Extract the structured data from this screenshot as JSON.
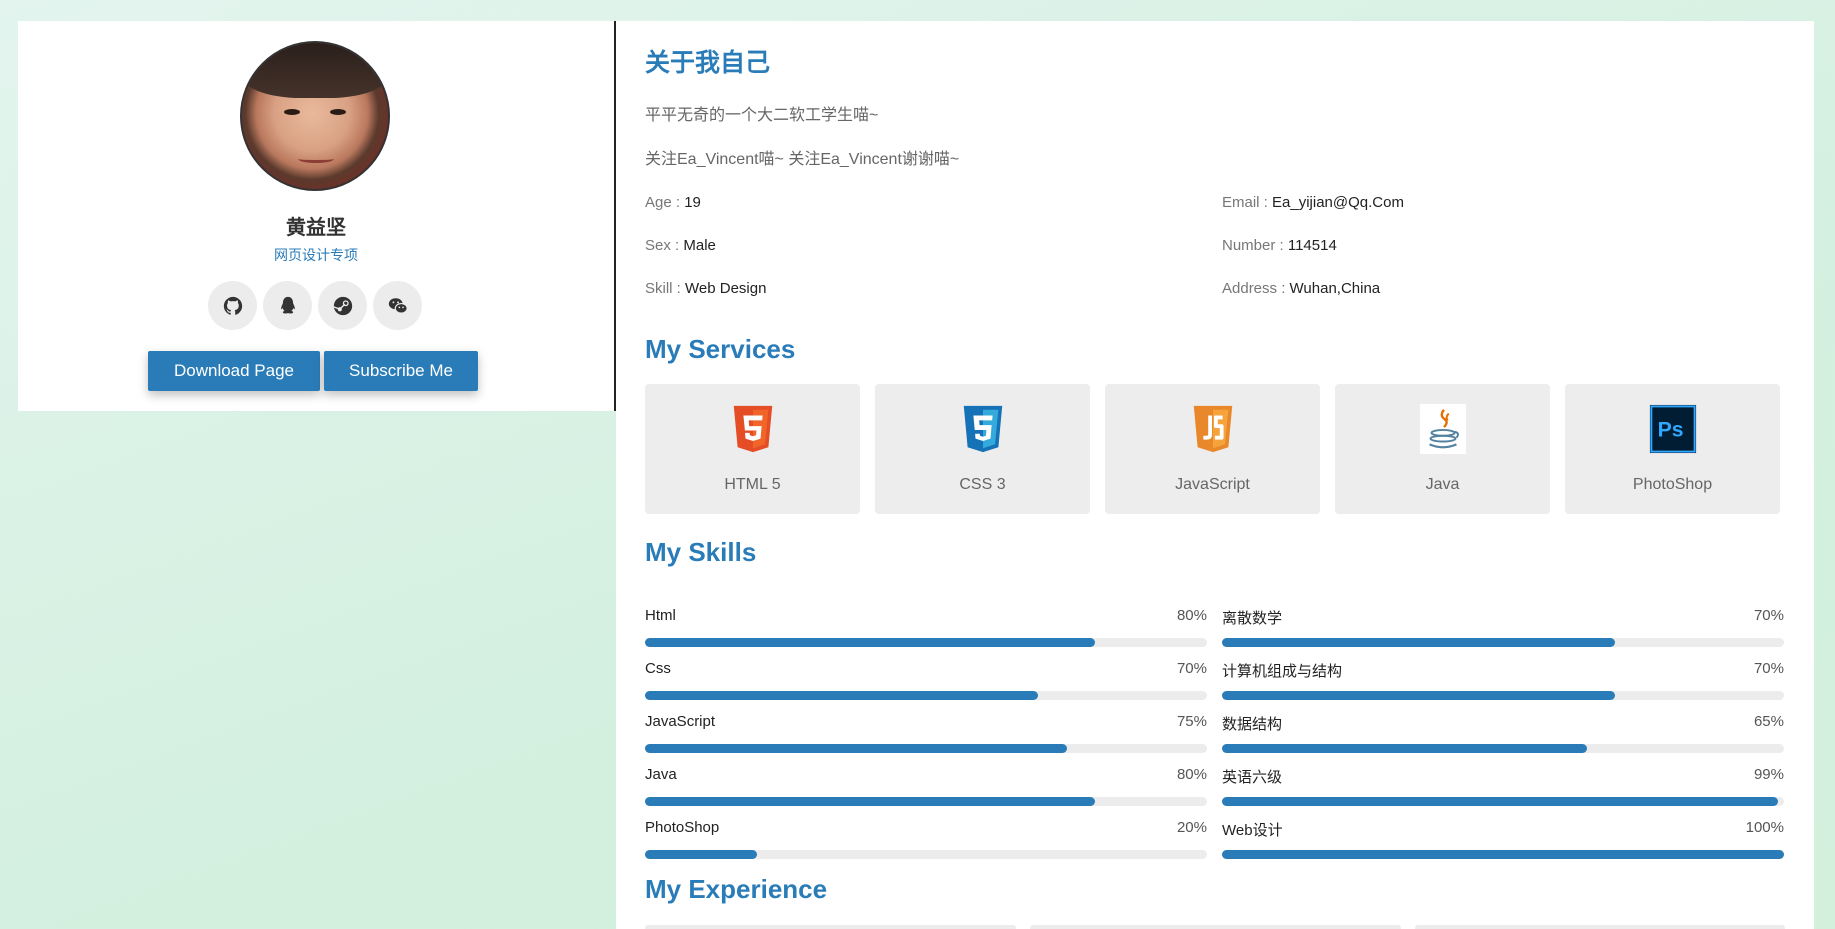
{
  "profile": {
    "name": "黄益坚",
    "subtitle": "网页设计专项",
    "socials": [
      "github-icon",
      "qq-icon",
      "steam-icon",
      "wechat-icon"
    ],
    "buttons": {
      "download": "Download Page",
      "subscribe": "Subscribe Me"
    }
  },
  "about": {
    "title": "关于我自己",
    "line1": "平平无奇的一个大二软工学生喵~",
    "line2": "关注Ea_Vincent喵~ 关注Ea_Vincent谢谢喵~",
    "info": [
      {
        "k": "Age : ",
        "v": "19"
      },
      {
        "k": "Email : ",
        "v": "Ea_yijian@Qq.Com"
      },
      {
        "k": "Sex : ",
        "v": "Male"
      },
      {
        "k": "Number : ",
        "v": "114514"
      },
      {
        "k": "Skill : ",
        "v": "Web Design"
      },
      {
        "k": "Address : ",
        "v": "Wuhan,China"
      }
    ]
  },
  "services": {
    "title": "My Services",
    "items": [
      {
        "label": "HTML 5",
        "icon": "html5-icon"
      },
      {
        "label": "CSS 3",
        "icon": "css3-icon"
      },
      {
        "label": "JavaScript",
        "icon": "javascript-icon"
      },
      {
        "label": "Java",
        "icon": "java-icon"
      },
      {
        "label": "PhotoShop",
        "icon": "photoshop-icon"
      }
    ]
  },
  "skills": {
    "title": "My Skills",
    "items": [
      {
        "name": "Html",
        "percent": "80%",
        "value": 80
      },
      {
        "name": "离散数学",
        "percent": "70%",
        "value": 70
      },
      {
        "name": "Css",
        "percent": "70%",
        "value": 70
      },
      {
        "name": "计算机组成与结构",
        "percent": "70%",
        "value": 70
      },
      {
        "name": "JavaScript",
        "percent": "75%",
        "value": 75
      },
      {
        "name": "数据结构",
        "percent": "65%",
        "value": 65
      },
      {
        "name": "Java",
        "percent": "80%",
        "value": 80
      },
      {
        "name": "英语六级",
        "percent": "99%",
        "value": 99
      },
      {
        "name": "PhotoShop",
        "percent": "20%",
        "value": 20
      },
      {
        "name": "Web设计",
        "percent": "100%",
        "value": 100
      }
    ]
  },
  "experience": {
    "title": "My Experience"
  },
  "colors": {
    "accent": "#2a7cb8",
    "card": "#ededed"
  }
}
